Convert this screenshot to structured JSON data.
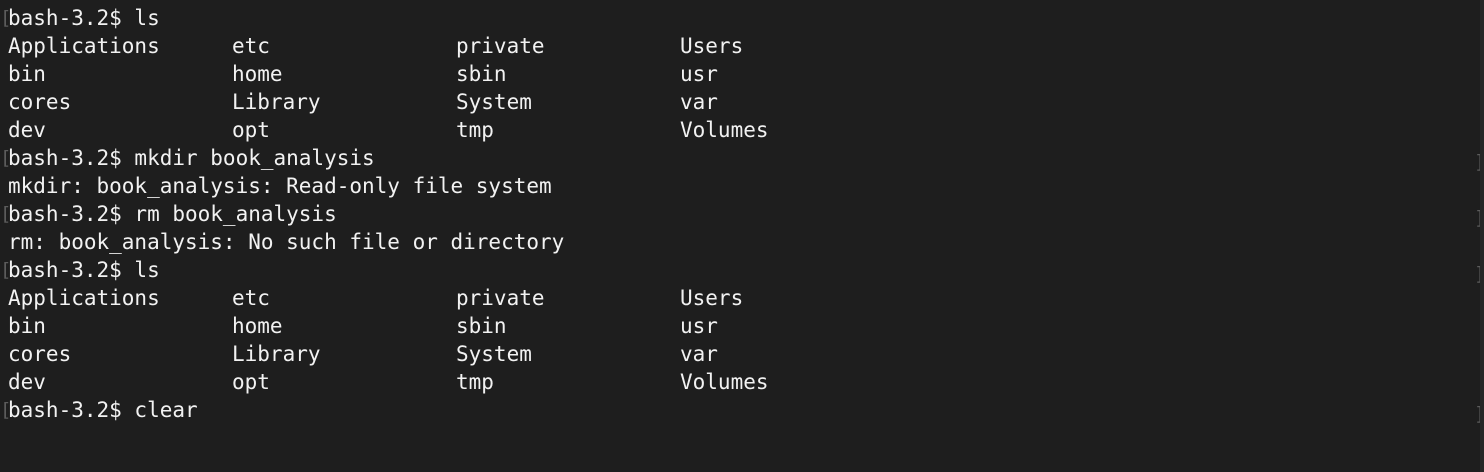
{
  "terminal": {
    "prompt": "bash-3.2$",
    "lines": [
      {
        "type": "cmd",
        "text": "bash-3.2$ ls"
      },
      {
        "type": "ls",
        "cols": [
          "Applications",
          "etc",
          "private",
          "Users"
        ]
      },
      {
        "type": "ls",
        "cols": [
          "bin",
          "home",
          "sbin",
          "usr"
        ]
      },
      {
        "type": "ls",
        "cols": [
          "cores",
          "Library",
          "System",
          "var"
        ]
      },
      {
        "type": "ls",
        "cols": [
          "dev",
          "opt",
          "tmp",
          "Volumes"
        ]
      },
      {
        "type": "cmd",
        "text": "bash-3.2$ mkdir book_analysis"
      },
      {
        "type": "out",
        "text": "mkdir: book_analysis: Read-only file system"
      },
      {
        "type": "cmd",
        "text": "bash-3.2$ rm book_analysis"
      },
      {
        "type": "out",
        "text": "rm: book_analysis: No such file or directory"
      },
      {
        "type": "cmd",
        "text": "bash-3.2$ ls"
      },
      {
        "type": "ls",
        "cols": [
          "Applications",
          "etc",
          "private",
          "Users"
        ]
      },
      {
        "type": "ls",
        "cols": [
          "bin",
          "home",
          "sbin",
          "usr"
        ]
      },
      {
        "type": "ls",
        "cols": [
          "cores",
          "Library",
          "System",
          "var"
        ]
      },
      {
        "type": "ls",
        "cols": [
          "dev",
          "opt",
          "tmp",
          "Volumes"
        ]
      },
      {
        "type": "cmd",
        "text": "bash-3.2$ clear"
      }
    ]
  },
  "colors": {
    "background": "#1e1e1e",
    "foreground": "#f2f2f2",
    "bracket": "#5c5c5c"
  }
}
